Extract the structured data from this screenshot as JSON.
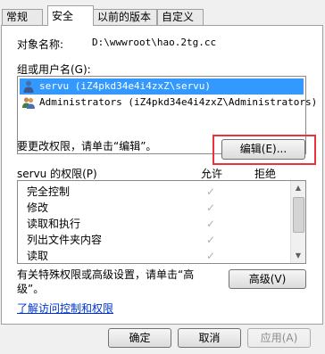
{
  "tabs": [
    {
      "label": "常规"
    },
    {
      "label": "安全"
    },
    {
      "label": "以前的版本"
    },
    {
      "label": "自定义"
    }
  ],
  "object": {
    "label": "对象名称:",
    "value": "D:\\wwwroot\\hao.2tg.cc"
  },
  "groups": {
    "label": "组或用户名(G):",
    "items": [
      {
        "label": "servu (iZ4pkd34e4i4zxZ\\servu)",
        "selected": true
      },
      {
        "label": "Administrators (iZ4pkd34e4i4zxZ\\Administrators)",
        "selected": false
      }
    ]
  },
  "edit": {
    "hint": "要更改权限，请单击“编辑”。",
    "button_label": "编辑(E)..."
  },
  "permissions": {
    "title": "servu 的权限(P)",
    "allow_header": "允许",
    "deny_header": "拒绝",
    "rows": [
      {
        "label": "完全控制",
        "allow": true,
        "deny": false
      },
      {
        "label": "修改",
        "allow": true,
        "deny": false
      },
      {
        "label": "读取和执行",
        "allow": true,
        "deny": false
      },
      {
        "label": "列出文件夹内容",
        "allow": true,
        "deny": false
      },
      {
        "label": "读取",
        "allow": true,
        "deny": false
      }
    ],
    "check_glyph": "✓"
  },
  "advanced": {
    "hint_line1": "有关特殊权限或高级设置，请单击“高",
    "hint_line2": "级”。",
    "button_label": "高级(V)"
  },
  "link": {
    "label": "了解访问控制和权限"
  },
  "footer": {
    "ok_label": "确定",
    "cancel_label": "取消",
    "apply_label": "应用(A)"
  },
  "colors": {
    "selection": "#3399ff",
    "highlight_border": "#e8323c",
    "link": "#0033cc"
  }
}
